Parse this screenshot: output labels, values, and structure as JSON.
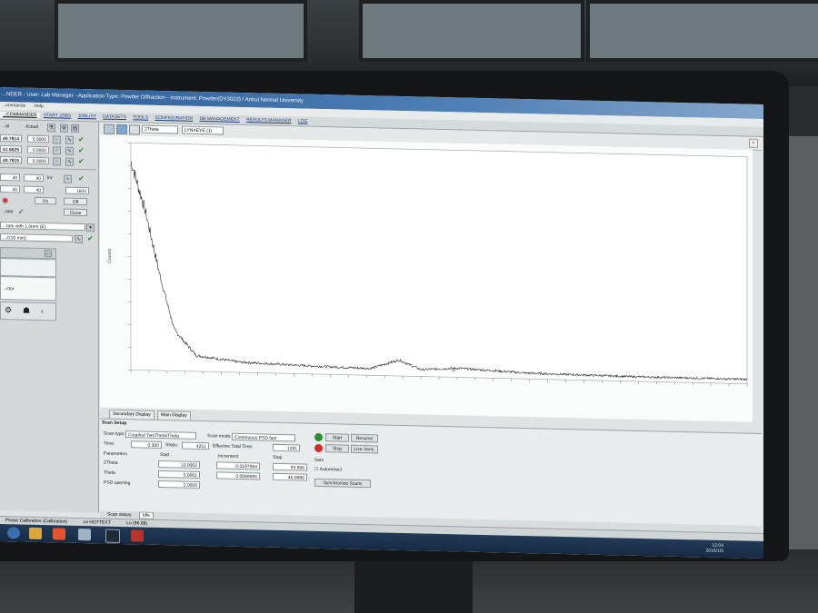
{
  "window": {
    "title": "...NDER - User: Lab Manager - Application Type: Powder Diffraction - Instrument: Powder(DY3023) / Anhui Normal University"
  },
  "menu": [
    "...ommands",
    "Help"
  ],
  "tabs": [
    "...COMMANDER",
    "START JOBS",
    "JOBLIST",
    "DATASETS",
    "TOOLS",
    "CONFIGURATION",
    "DB MANAGEMENT",
    "RESULTS MANAGER",
    "LOG"
  ],
  "left": {
    "header_label": "...al",
    "header_label2": "Actual",
    "rows": [
      {
        "value": "40.7814",
        "actual": "0.0000"
      },
      {
        "value": "41.5625",
        "actual": "0.0000"
      },
      {
        "value": "40.7815",
        "actual": "0.0000"
      }
    ],
    "gen": {
      "v1": "40",
      "v2": "40",
      "v3": "40",
      "v4": "40",
      "unit": "kV",
      "power": "1600"
    },
    "buttons": {
      "on": "On",
      "off": "Off",
      "close": "Close"
    },
    "option_label": "...tate",
    "dropdown1": "...tate with 1.0mm (E)",
    "dropdown2": "...2(10 mm)",
    "panel_item": "...ctor"
  },
  "chart_toolbar": {
    "drop1": "2Theta",
    "drop2": "LYNXEYE (1)"
  },
  "chart_data": {
    "type": "line",
    "ylabel": "Counts",
    "xlim": [
      5,
      90
    ],
    "ylim": [
      0,
      1000
    ],
    "peaks": [
      {
        "x": 5,
        "y": 920
      },
      {
        "x": 7,
        "y": 700
      },
      {
        "x": 9,
        "y": 420
      },
      {
        "x": 11,
        "y": 180
      },
      {
        "x": 14,
        "y": 70
      },
      {
        "x": 20,
        "y": 45
      },
      {
        "x": 30,
        "y": 35
      },
      {
        "x": 38,
        "y": 30
      },
      {
        "x": 42,
        "y": 70
      },
      {
        "x": 45,
        "y": 30
      },
      {
        "x": 50,
        "y": 40
      },
      {
        "x": 60,
        "y": 25
      },
      {
        "x": 75,
        "y": 20
      },
      {
        "x": 90,
        "y": 20
      }
    ]
  },
  "subtabs": [
    "Secondary Display",
    "Main Display"
  ],
  "scan": {
    "header": "Scan Setup",
    "scan_type_label": "Scan type:",
    "scan_type_value": "Coupled TwoTheta/Theta",
    "scan_mode_label": "Scan mode:",
    "scan_mode_value": "Continuous PSD fast",
    "time_label": "Time:",
    "time_value": "0.300",
    "steps_label": "Steps:",
    "steps_value": "4251",
    "eff_time_label": "Effective Total Time:",
    "eff_time_value": "1281",
    "col_param": "Parameters",
    "col_start": "Start",
    "col_incr": "Increment",
    "col_stop": "Stop",
    "params": [
      {
        "name": "2Theta",
        "start": "10.0002",
        "incr": "0.0197984",
        "stop": "93.996"
      },
      {
        "name": "Theta",
        "start": "5.0001",
        "incr": "0.0099995",
        "stop": "46.9980"
      },
      {
        "name": "PSD opening",
        "start": "2.0000",
        "incr": "",
        "stop": ""
      }
    ],
    "btn_start": "Start",
    "btn_resume": "Resume",
    "btn_stop": "Stop",
    "btn_live": "Live Sens.",
    "options_label": "Sets",
    "autoretract": "Autoretract",
    "btn_synch": "Synchronize Scans",
    "status_label": "Scan status:",
    "status_value": "Idle"
  },
  "statusbar": [
    "Phase Calibration (Calibration)",
    "Le HOTTEXT",
    "Lo (96.08)"
  ],
  "clock": {
    "time": "12:04",
    "date": "2016/1/5"
  }
}
